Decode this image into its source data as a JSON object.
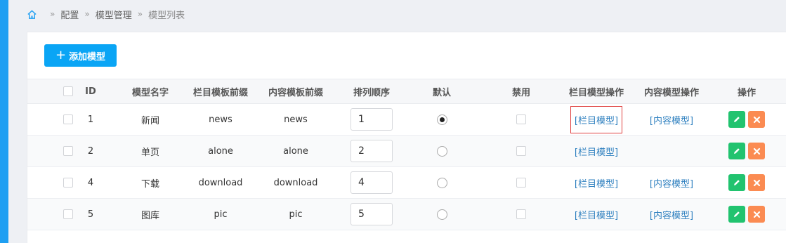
{
  "breadcrumb": {
    "items": [
      "配置",
      "模型管理",
      "模型列表"
    ],
    "separator": "»"
  },
  "toolbar": {
    "add_label": "添加模型",
    "add_icon": "+"
  },
  "table": {
    "headers": {
      "id": "ID",
      "name": "模型名字",
      "column_prefix": "栏目模板前缀",
      "content_prefix": "内容模板前缀",
      "sort": "排列顺序",
      "default": "默认",
      "disabled": "禁用",
      "column_ops": "栏目模型操作",
      "content_ops": "内容模型操作",
      "actions": "操作"
    },
    "rows": [
      {
        "id": "1",
        "name": "新闻",
        "column_prefix": "news",
        "content_prefix": "news",
        "sort": "1",
        "is_default": true,
        "column_link": "[栏目模型]",
        "content_link": "[内容模型]"
      },
      {
        "id": "2",
        "name": "单页",
        "column_prefix": "alone",
        "content_prefix": "alone",
        "sort": "2",
        "is_default": false,
        "column_link": "[栏目模型]",
        "content_link": ""
      },
      {
        "id": "4",
        "name": "下载",
        "column_prefix": "download",
        "content_prefix": "download",
        "sort": "4",
        "is_default": false,
        "column_link": "[栏目模型]",
        "content_link": "[内容模型]"
      },
      {
        "id": "5",
        "name": "图库",
        "column_prefix": "pic",
        "content_prefix": "pic",
        "sort": "5",
        "is_default": false,
        "column_link": "[栏目模型]",
        "content_link": "[内容模型]"
      }
    ]
  },
  "colors": {
    "primary": "#0aa5f5",
    "sidebar": "#1e9ff2",
    "link": "#2d7fbf",
    "edit": "#21c36f",
    "delete": "#fb8b52",
    "highlight_border": "#e0403f"
  },
  "icons": {
    "home": "home-icon",
    "edit": "pencil-icon",
    "delete": "close-icon"
  }
}
